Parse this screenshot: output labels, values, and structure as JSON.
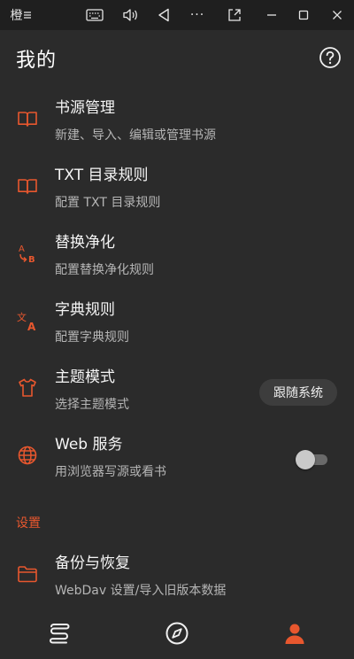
{
  "window": {
    "app_glyph": "橙",
    "buttons": [
      {
        "icon": "keyboard-icon"
      },
      {
        "icon": "volume-icon"
      },
      {
        "icon": "back-icon"
      },
      {
        "icon": "more-icon",
        "label": "···"
      },
      {
        "icon": "pin-icon"
      },
      {
        "icon": "minimize-icon"
      },
      {
        "icon": "maximize-icon"
      },
      {
        "icon": "close-icon"
      }
    ]
  },
  "header": {
    "title": "我的",
    "help_icon": "help-icon"
  },
  "colors": {
    "accent": "#e8572e",
    "background": "#2b2b2b",
    "titlebar": "#1f1f1f"
  },
  "items": [
    {
      "icon": "book-icon",
      "title": "书源管理",
      "subtitle": "新建、导入、编辑或管理书源"
    },
    {
      "icon": "book-icon",
      "title": "TXT 目录规则",
      "subtitle": "配置 TXT 目录规则"
    },
    {
      "icon": "replace-icon",
      "title": "替换净化",
      "subtitle": "配置替换净化规则",
      "icon_text": [
        "A",
        "B"
      ]
    },
    {
      "icon": "translate-icon",
      "title": "字典规则",
      "subtitle": "配置字典规则",
      "icon_text": [
        "文",
        "A"
      ]
    },
    {
      "icon": "shirt-icon",
      "title": "主题模式",
      "subtitle": "选择主题模式",
      "value": "跟随系统"
    },
    {
      "icon": "globe-icon",
      "title": "Web 服务",
      "subtitle": "用浏览器写源或看书",
      "switch_on": false
    },
    {
      "icon": "folder-icon",
      "title": "备份与恢复",
      "subtitle": "WebDav 设置/导入旧版本数据"
    }
  ],
  "section_label": "设置",
  "bottom_nav": [
    {
      "icon": "bookshelf-icon",
      "active": false
    },
    {
      "icon": "compass-icon",
      "active": false
    },
    {
      "icon": "person-icon",
      "active": true
    }
  ]
}
